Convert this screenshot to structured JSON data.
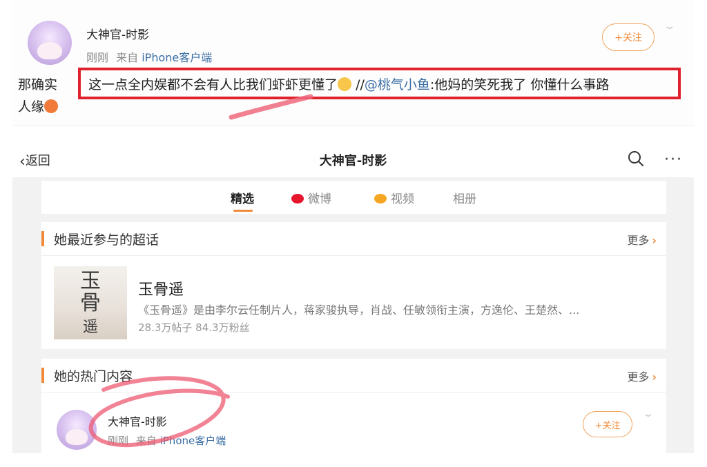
{
  "top_post": {
    "username": "大神官-时影",
    "time": "刚刚",
    "source_prefix": "来自",
    "source": "iPhone客户端",
    "follow_label": "+关注",
    "text_prefix": "那确实",
    "highlight_text": "这一点全内娱都不会有人比我们虾虾更懂了",
    "repost_sep": "//",
    "mention": "@桃气小鱼",
    "highlight_tail": ":他妈的笑死我了 你懂什么事路",
    "text_line2": "人缘"
  },
  "nav": {
    "back_label": "返回",
    "title": "大神官-时影",
    "more_glyph": "···"
  },
  "tabs": [
    {
      "label": "精选",
      "active": true
    },
    {
      "label": "微博",
      "active": false,
      "icon": "weibo-icon"
    },
    {
      "label": "视频",
      "active": false,
      "icon": "video-icon"
    },
    {
      "label": "相册",
      "active": false
    }
  ],
  "super_topics": {
    "title": "她最近参与的超话",
    "more_label": "更多",
    "item": {
      "cover_text": "玉骨遥",
      "name": "玉骨遥",
      "description": "《玉骨遥》是由李尔云任制片人，蒋家骏执导，肖战、任敏领衔主演，方逸伦、王楚然、...",
      "stats": "28.3万帖子 84.3万粉丝"
    }
  },
  "hot_content": {
    "title": "她的热门内容",
    "more_label": "更多",
    "post": {
      "username": "大神官-时影",
      "time": "刚刚",
      "source_prefix": "来自",
      "source": "iPhone客户端",
      "follow_label": "+关注"
    }
  },
  "colors": {
    "accent": "#f08a3a",
    "link": "#3a6ea5",
    "annotation_red": "#e0222e"
  }
}
